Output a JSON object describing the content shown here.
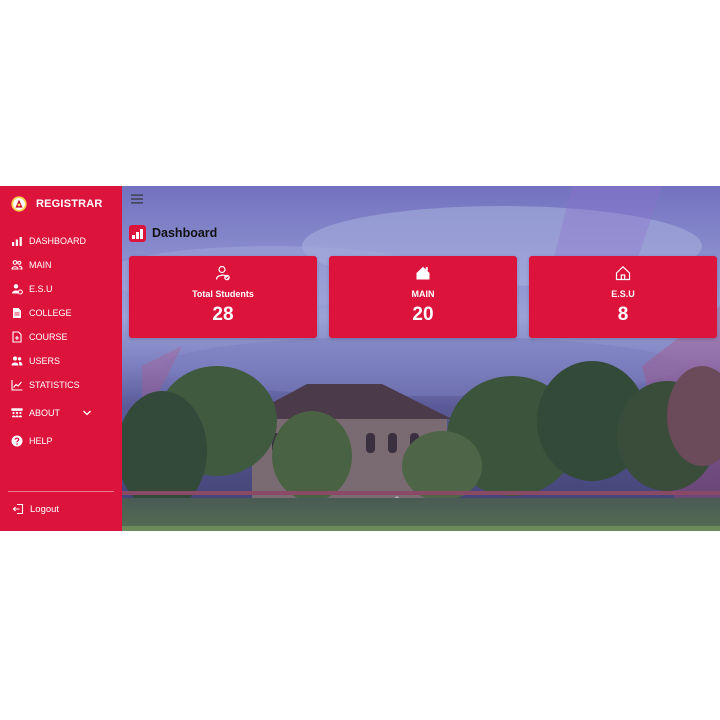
{
  "brand": {
    "name": "REGISTRAR"
  },
  "sidebar": {
    "items": [
      {
        "label": "DASHBOARD",
        "icon": "bar-chart-icon"
      },
      {
        "label": "MAIN",
        "icon": "users-outline-icon"
      },
      {
        "label": "E.S.U",
        "icon": "user-gear-icon"
      },
      {
        "label": "COLLEGE",
        "icon": "document-icon"
      },
      {
        "label": "COURSE",
        "icon": "add-file-icon"
      },
      {
        "label": "USERS",
        "icon": "users-icon"
      },
      {
        "label": "STATISTICS",
        "icon": "line-chart-icon"
      },
      {
        "label": "ABOUT",
        "icon": "group-icon"
      },
      {
        "label": "HELP",
        "icon": "help-icon"
      }
    ],
    "logout_label": "Logout"
  },
  "main": {
    "title": "Dashboard",
    "cards": [
      {
        "label": "Total Students",
        "value": "28",
        "icon": "user-check-icon"
      },
      {
        "label": "MAIN",
        "value": "20",
        "icon": "home-filled-icon"
      },
      {
        "label": "E.S.U",
        "value": "8",
        "icon": "home-outline-icon"
      }
    ]
  },
  "colors": {
    "accent": "#dc143c",
    "background": "#ffffff"
  }
}
